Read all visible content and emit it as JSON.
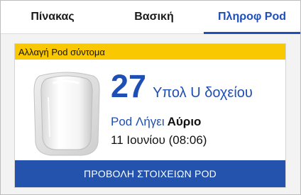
{
  "tabs": [
    {
      "label": "Πίνακας",
      "active": false
    },
    {
      "label": "Βασική",
      "active": false
    },
    {
      "label": "Πληροφ Pod",
      "active": true
    }
  ],
  "pod_card": {
    "warning_banner": "Αλλαγή Pod σύντομα",
    "image_icon": "pod-device-image",
    "units_remaining": "27",
    "units_label": "Υπολ U δοχείου",
    "expiry_label": "Pod Λήγει",
    "expiry_when": "Αύριο",
    "expiry_datetime": "11 Ιουνίου (08:06)",
    "details_button": "ΠΡΟΒΟΛΗ ΣΤΟΙΧΕΙΩΝ POD"
  },
  "colors": {
    "accent": "#1e4fb6",
    "button": "#2353ad",
    "warning": "#f9c800"
  }
}
